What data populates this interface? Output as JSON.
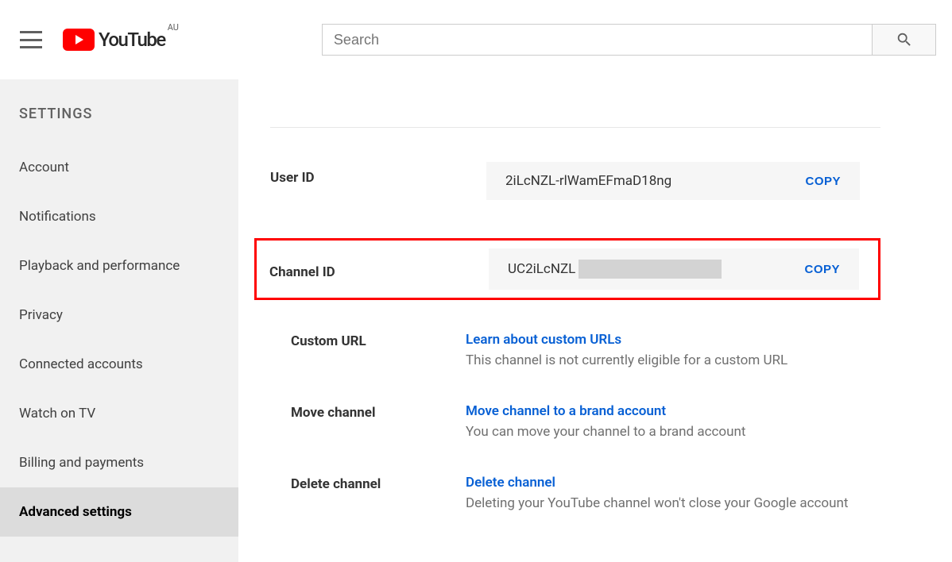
{
  "header": {
    "brand": "YouTube",
    "region": "AU",
    "search_placeholder": "Search"
  },
  "sidebar": {
    "title": "SETTINGS",
    "items": [
      {
        "label": "Account"
      },
      {
        "label": "Notifications"
      },
      {
        "label": "Playback and performance"
      },
      {
        "label": "Privacy"
      },
      {
        "label": "Connected accounts"
      },
      {
        "label": "Watch on TV"
      },
      {
        "label": "Billing and payments"
      },
      {
        "label": "Advanced settings"
      }
    ]
  },
  "content": {
    "user_id_label": "User ID",
    "user_id_value": "2iLcNZL-rlWamEFmaD18ng",
    "channel_id_label": "Channel ID",
    "channel_id_value": "UC2iLcNZL",
    "copy_label": "COPY",
    "custom_url": {
      "label": "Custom URL",
      "link": "Learn about custom URLs",
      "desc": "This channel is not currently eligible for a custom URL"
    },
    "move_channel": {
      "label": "Move channel",
      "link": "Move channel to a brand account",
      "desc": "You can move your channel to a brand account"
    },
    "delete_channel": {
      "label": "Delete channel",
      "link": "Delete channel",
      "desc": "Deleting your YouTube channel won't close your Google account"
    }
  }
}
